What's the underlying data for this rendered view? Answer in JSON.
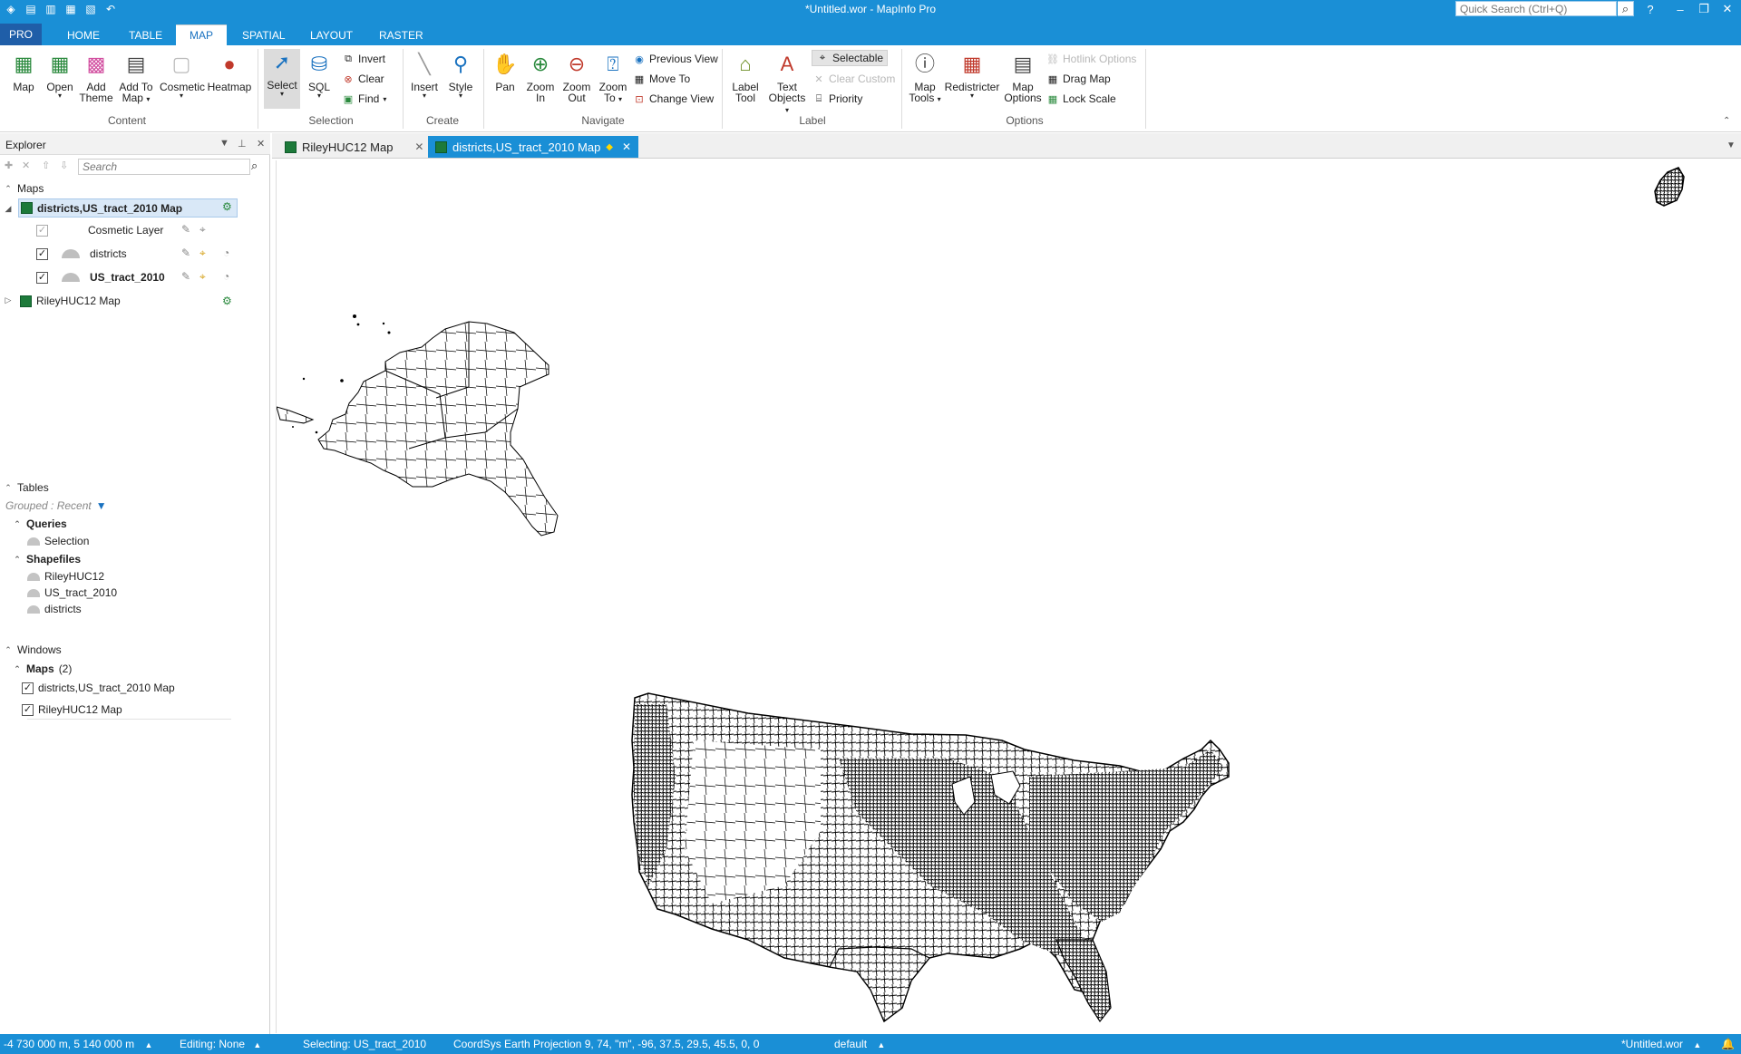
{
  "titlebar": {
    "title": "*Untitled.wor - MapInfo Pro",
    "quick_search_placeholder": "Quick Search (Ctrl+Q)",
    "help": "?"
  },
  "ribbon_tabs": [
    "PRO",
    "HOME",
    "TABLE",
    "MAP",
    "SPATIAL",
    "LAYOUT",
    "RASTER"
  ],
  "active_tab": "MAP",
  "ribbon": {
    "content": {
      "group": "Content",
      "map": "Map",
      "open": "Open",
      "add_theme_1": "Add",
      "add_theme_2": "Theme",
      "add_to_map_1": "Add To",
      "add_to_map_2": "Map",
      "cosmetic": "Cosmetic",
      "heatmap": "Heatmap"
    },
    "selection": {
      "group": "Selection",
      "select": "Select",
      "sql": "SQL",
      "invert": "Invert",
      "clear": "Clear",
      "find": "Find"
    },
    "create": {
      "group": "Create",
      "insert": "Insert",
      "style": "Style"
    },
    "navigate": {
      "group": "Navigate",
      "pan": "Pan",
      "zoom_in_1": "Zoom",
      "zoom_in_2": "In",
      "zoom_out_1": "Zoom",
      "zoom_out_2": "Out",
      "zoom_to_1": "Zoom",
      "zoom_to_2": "To",
      "previous_view": "Previous View",
      "move_to": "Move To",
      "change_view": "Change View"
    },
    "label": {
      "group": "Label",
      "label_tool_1": "Label",
      "label_tool_2": "Tool",
      "text_objects_1": "Text",
      "text_objects_2": "Objects",
      "selectable": "Selectable",
      "clear_custom": "Clear Custom",
      "priority": "Priority"
    },
    "options": {
      "group": "Options",
      "map_tools_1": "Map",
      "map_tools_2": "Tools",
      "redistricter": "Redistricter",
      "map_options_1": "Map",
      "map_options_2": "Options",
      "hotlink_options": "Hotlink Options",
      "drag_map": "Drag Map",
      "lock_scale": "Lock Scale"
    }
  },
  "explorer": {
    "title": "Explorer",
    "search_placeholder": "Search",
    "maps_header": "Maps",
    "maps": [
      {
        "name": "districts,US_tract_2010 Map",
        "layers": [
          "Cosmetic Layer",
          "districts",
          "US_tract_2010"
        ]
      },
      {
        "name": "RileyHUC12 Map"
      }
    ],
    "tables_header": "Tables",
    "grouped": "Grouped : Recent",
    "queries_header": "Queries",
    "queries": [
      "Selection"
    ],
    "shapefiles_header": "Shapefiles",
    "shapefiles": [
      "RileyHUC12",
      "US_tract_2010",
      "districts"
    ],
    "windows_header": "Windows",
    "windows_maps_header": "Maps",
    "windows_maps_count": "(2)",
    "windows": [
      "districts,US_tract_2010 Map",
      "RileyHUC12 Map"
    ]
  },
  "doc_tabs": [
    {
      "label": "RileyHUC12 Map",
      "active": false
    },
    {
      "label": "districts,US_tract_2010 Map",
      "active": true
    }
  ],
  "status": {
    "coords": "-4 730 000 m, 5 140 000 m",
    "editing": "Editing: None",
    "selecting": "Selecting: US_tract_2010",
    "coordsys": "CoordSys Earth Projection 9, 74, \"m\", -96, 37.5, 29.5, 45.5, 0, 0",
    "style": "default",
    "workspace": "*Untitled.wor"
  },
  "colors": {
    "accent": "#1a8fd6",
    "pro_tab": "#1f5ea8"
  }
}
